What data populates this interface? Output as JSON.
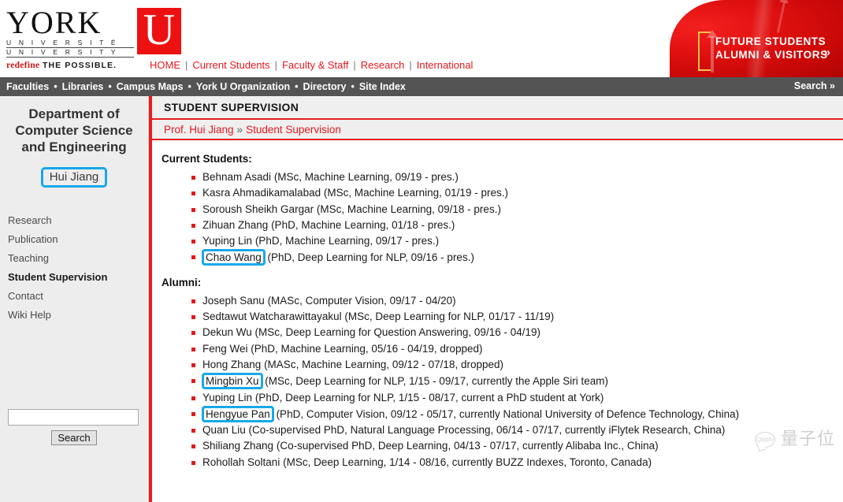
{
  "colors": {
    "brand_red": "#e8181f",
    "nav_grey": "#545454",
    "sidebar_grey": "#ededed",
    "highlight_cyan": "#18a8e8",
    "bullet_red": "#e01b1b"
  },
  "banner": {
    "logo": {
      "word": "YORK",
      "u_letter": "U",
      "line_fr": "U N I V E R S I T É",
      "line_en": "U N I V E R S I T Y",
      "tagline_red": "redefine",
      "tagline_black": "THE POSSIBLE."
    },
    "cta": {
      "line1": "FUTURE STUDENTS",
      "line2": "ALUMNI & VISITORS",
      "chevron": "»"
    },
    "top_links": [
      "HOME",
      "Current Students",
      "Faculty & Staff",
      "Research",
      "International"
    ],
    "separator": "|"
  },
  "navbar": {
    "items": [
      "Faculties",
      "Libraries",
      "Campus Maps",
      "York U Organization",
      "Directory",
      "Site Index"
    ],
    "bullet": "•",
    "search_label": "Search »"
  },
  "sidebar": {
    "department": "Department of Computer Science and Engineering",
    "professor": "Hui Jiang",
    "menu": [
      {
        "label": "Research",
        "active": false
      },
      {
        "label": "Publication",
        "active": false
      },
      {
        "label": "Teaching",
        "active": false
      },
      {
        "label": "Student Supervision",
        "active": true
      },
      {
        "label": "Contact",
        "active": false
      },
      {
        "label": "Wiki Help",
        "active": false
      }
    ],
    "search": {
      "value": "",
      "placeholder": "",
      "button_label": "Search"
    }
  },
  "main": {
    "page_title": "STUDENT SUPERVISION",
    "breadcrumb": {
      "parent": "Prof. Hui Jiang",
      "separator": "»",
      "current": "Student Supervision"
    },
    "current_students_heading": "Current Students:",
    "alumni_heading": "Alumni:",
    "current_students": [
      {
        "name": "Behnam Asadi",
        "highlight": false,
        "detail": " (MSc, Machine Learning, 09/19 - pres.)"
      },
      {
        "name": "Kasra Ahmadikamalabad",
        "highlight": false,
        "detail": " (MSc, Machine Learning, 01/19 - pres.)"
      },
      {
        "name": "Soroush Sheikh Gargar",
        "highlight": false,
        "detail": " (MSc, Machine Learning, 09/18 - pres.)"
      },
      {
        "name": "Zihuan Zhang",
        "highlight": false,
        "detail": " (PhD, Machine Learning, 01/18 - pres.)"
      },
      {
        "name": "Yuping Lin",
        "highlight": false,
        "detail": " (PhD, Machine Learning, 09/17 - pres.)"
      },
      {
        "name": "Chao Wang",
        "highlight": true,
        "detail": " (PhD, Deep Learning for NLP, 09/16 - pres.)"
      }
    ],
    "alumni": [
      {
        "name": "Joseph Sanu",
        "highlight": false,
        "detail": " (MASc, Computer Vision, 09/17 - 04/20)"
      },
      {
        "name": "Sedtawut Watcharawittayakul",
        "highlight": false,
        "detail": " (MSc, Deep Learning for NLP, 01/17 - 11/19)"
      },
      {
        "name": "Dekun Wu",
        "highlight": false,
        "detail": " (MSc, Deep Learning for Question Answering, 09/16 - 04/19)"
      },
      {
        "name": "Feng Wei",
        "highlight": false,
        "detail": " (PhD, Machine Learning, 05/16 - 04/19, dropped)"
      },
      {
        "name": "Hong Zhang",
        "highlight": false,
        "detail": " (MASc, Machine Learning, 09/12 - 07/18, dropped)"
      },
      {
        "name": "Mingbin Xu",
        "highlight": true,
        "detail": " (MSc, Deep Learning for NLP, 1/15 - 09/17, currently the Apple Siri team)"
      },
      {
        "name": "Yuping Lin",
        "highlight": false,
        "detail": " (PhD, Deep Learning for NLP, 1/15 - 08/17, current a PhD student at York)"
      },
      {
        "name": "Hengyue Pan",
        "highlight": true,
        "detail": " (PhD, Computer Vision, 09/12 - 05/17, currently National University of Defence Technology, China)"
      },
      {
        "name": "Quan Liu",
        "highlight": false,
        "detail": " (Co-supervised PhD, Natural Language Processing, 06/14 - 07/17, currently iFlytek Research, China)"
      },
      {
        "name": "Shiliang Zhang",
        "highlight": false,
        "detail": " (Co-supervised PhD, Deep Learning, 04/13 - 07/17, currently Alibaba Inc., China)"
      },
      {
        "name": "Rohollah Soltani",
        "highlight": false,
        "detail": " (MSc, Deep Learning, 1/14 - 08/16, currently BUZZ Indexes, Toronto, Canada)"
      }
    ]
  },
  "watermark": {
    "bubble_text": "QbitAI",
    "text": "量子位"
  }
}
